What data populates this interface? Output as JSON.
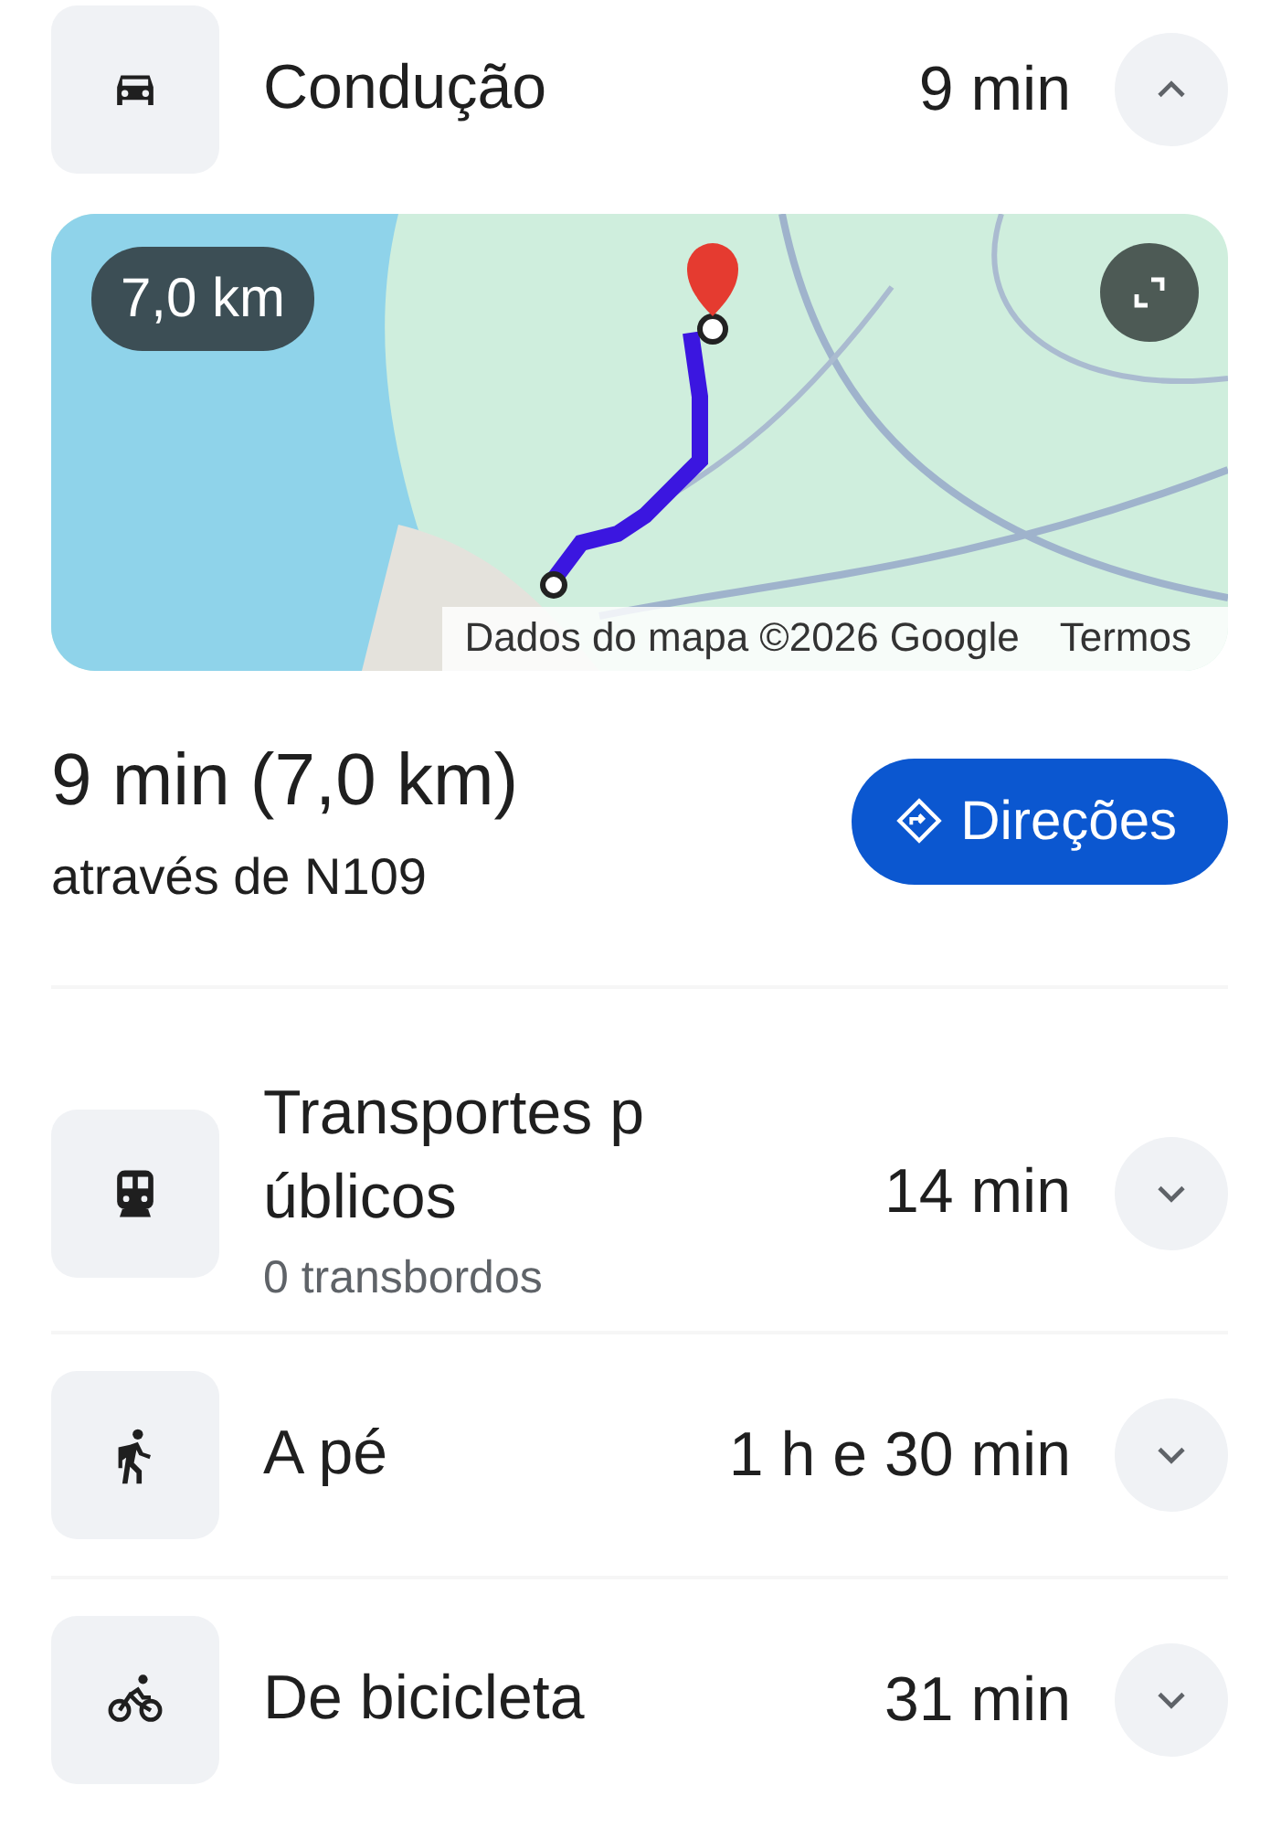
{
  "modes": [
    {
      "kind": "car",
      "title": "Condução",
      "time": "9 min",
      "expanded": true,
      "details": {
        "map": {
          "kind": "picture",
          "distance_badge": "7,0 km",
          "attribution": "Dados do mapa ©2026 Google",
          "terms": "Termos"
        },
        "summary": "9 min (7,0 km)",
        "via": "através de N109",
        "button": "Direções"
      }
    },
    {
      "kind": "transit",
      "title": "Transportes públicos",
      "subtitle": "0 transbordos",
      "time": "14 min",
      "expanded": false
    },
    {
      "kind": "walk",
      "title": "A pé",
      "time": "1 h e 30 min",
      "expanded": false
    },
    {
      "kind": "bike",
      "title": "De bicicleta",
      "time": "31 min",
      "expanded": false
    }
  ]
}
